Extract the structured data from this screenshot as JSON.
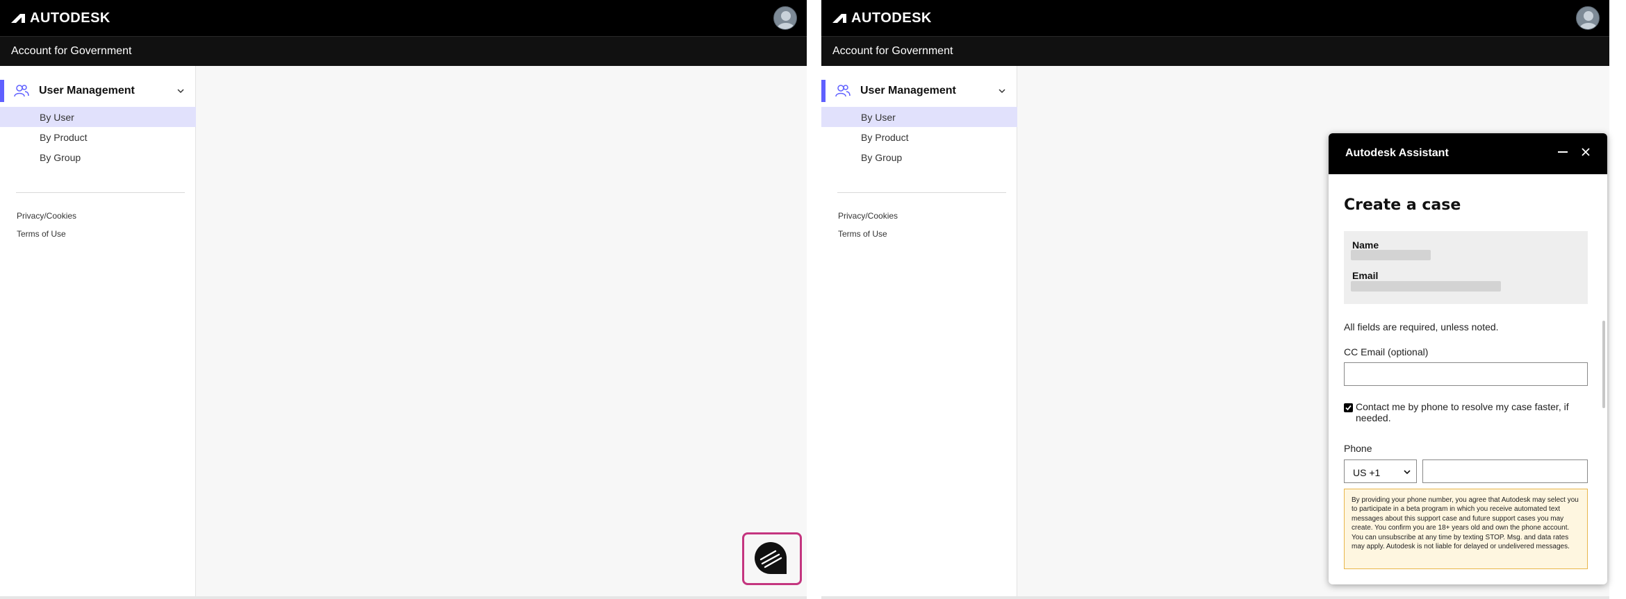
{
  "brand": {
    "name": "AUTODESK"
  },
  "header": {
    "subtitle": "Account for Government"
  },
  "sidebar": {
    "section_label": "User Management",
    "items": [
      {
        "label": "By User",
        "active": true
      },
      {
        "label": "By Product",
        "active": false
      },
      {
        "label": "By Group",
        "active": false
      }
    ],
    "footer_links": [
      "Privacy/Cookies",
      "Terms of Use"
    ]
  },
  "assistant": {
    "title": "Autodesk Assistant",
    "case_title": "Create a case",
    "name_label": "Name",
    "email_label": "Email",
    "required_note": "All fields are required, unless noted.",
    "cc_label": "CC Email (optional)",
    "cc_value": "",
    "contact_checkbox_label": "Contact me by phone to resolve my case faster, if needed.",
    "contact_checked": true,
    "phone_label": "Phone",
    "country_code": "US +1",
    "phone_value": "",
    "disclaimer": "By providing your phone number, you agree that Autodesk may select you to participate in a beta program in which you receive automated text messages about this support case and future support cases you may create. You confirm you are 18+ years old and own the phone account. You can unsubscribe at any time by texting STOP. Msg. and data rates may apply. Autodesk is not liable for delayed or undelivered messages."
  },
  "colors": {
    "accent": "#5f60ff",
    "active_item_bg": "#e1e1fc",
    "launcher_highlight": "#c4357f",
    "disclaimer_bg": "#fef6e0",
    "disclaimer_border": "#e8b64b"
  },
  "icons": {
    "logo": "autodesk-logo-icon",
    "avatar": "user-avatar-icon",
    "section": "users-icon",
    "chevron": "chevron-down-icon",
    "launcher": "chat-bubble-icon",
    "minimize": "minimize-icon",
    "close": "close-icon"
  }
}
